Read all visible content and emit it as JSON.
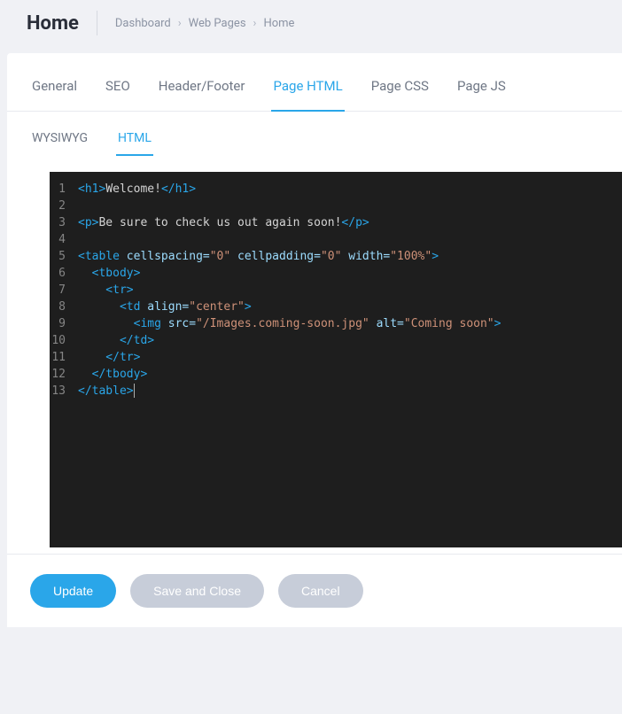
{
  "header": {
    "title": "Home",
    "breadcrumb": [
      "Dashboard",
      "Web Pages",
      "Home"
    ]
  },
  "tabs": {
    "main": [
      {
        "id": "general",
        "label": "General",
        "active": false
      },
      {
        "id": "seo",
        "label": "SEO",
        "active": false
      },
      {
        "id": "header-footer",
        "label": "Header/Footer",
        "active": false
      },
      {
        "id": "page-html",
        "label": "Page HTML",
        "active": true
      },
      {
        "id": "page-css",
        "label": "Page CSS",
        "active": false
      },
      {
        "id": "page-js",
        "label": "Page JS",
        "active": false
      }
    ],
    "sub": [
      {
        "id": "wysiwyg",
        "label": "WYSIWYG",
        "active": false
      },
      {
        "id": "html",
        "label": "HTML",
        "active": true
      }
    ]
  },
  "code": {
    "lines": [
      [
        {
          "c": "tag",
          "t": "<h1>"
        },
        {
          "c": "text",
          "t": "Welcome!"
        },
        {
          "c": "tag",
          "t": "</h1>"
        }
      ],
      [],
      [
        {
          "c": "tag",
          "t": "<p>"
        },
        {
          "c": "text",
          "t": "Be sure to check us out again soon!"
        },
        {
          "c": "tag",
          "t": "</p>"
        }
      ],
      [],
      [
        {
          "c": "tag",
          "t": "<table "
        },
        {
          "c": "attr",
          "t": "cellspacing="
        },
        {
          "c": "str",
          "t": "\"0\""
        },
        {
          "c": "tag",
          "t": " "
        },
        {
          "c": "attr",
          "t": "cellpadding="
        },
        {
          "c": "str",
          "t": "\"0\""
        },
        {
          "c": "tag",
          "t": " "
        },
        {
          "c": "attr",
          "t": "width="
        },
        {
          "c": "str",
          "t": "\"100%\""
        },
        {
          "c": "tag",
          "t": ">"
        }
      ],
      [
        {
          "c": "tag",
          "t": "  <tbody>"
        }
      ],
      [
        {
          "c": "tag",
          "t": "    <tr>"
        }
      ],
      [
        {
          "c": "tag",
          "t": "      <td "
        },
        {
          "c": "attr",
          "t": "align="
        },
        {
          "c": "str",
          "t": "\"center\""
        },
        {
          "c": "tag",
          "t": ">"
        }
      ],
      [
        {
          "c": "tag",
          "t": "        <img "
        },
        {
          "c": "attr",
          "t": "src="
        },
        {
          "c": "str",
          "t": "\"/Images.coming-soon.jpg\""
        },
        {
          "c": "tag",
          "t": " "
        },
        {
          "c": "attr",
          "t": "alt="
        },
        {
          "c": "str",
          "t": "\"Coming soon\""
        },
        {
          "c": "tag",
          "t": ">"
        }
      ],
      [
        {
          "c": "tag",
          "t": "      </td>"
        }
      ],
      [
        {
          "c": "tag",
          "t": "    </tr>"
        }
      ],
      [
        {
          "c": "tag",
          "t": "  </tbody>"
        }
      ],
      [
        {
          "c": "tag",
          "t": "</table>"
        }
      ]
    ]
  },
  "footer": {
    "update": "Update",
    "saveclose": "Save and Close",
    "cancel": "Cancel"
  }
}
